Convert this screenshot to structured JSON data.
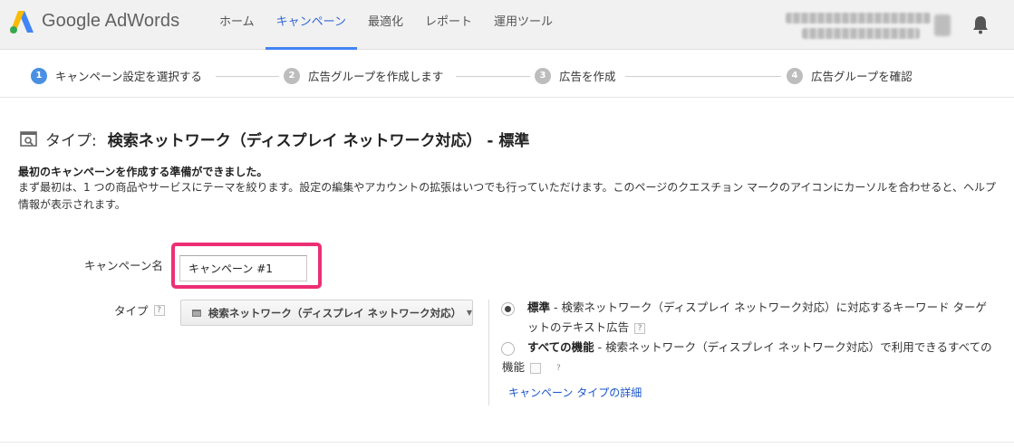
{
  "app": {
    "brand": "Google AdWords",
    "colors": {
      "accent": "#4285f4",
      "highlight": "#ec2f75",
      "step_active": "#4a90e2",
      "link": "#1a55c9"
    }
  },
  "nav": {
    "items": [
      {
        "label": "ホーム",
        "active": false
      },
      {
        "label": "キャンペーン",
        "active": true
      },
      {
        "label": "最適化",
        "active": false
      },
      {
        "label": "レポート",
        "active": false
      },
      {
        "label": "運用ツール",
        "active": false
      }
    ],
    "bell_icon": "bell-icon"
  },
  "steps": [
    {
      "num": "1",
      "label": "キャンペーン設定を選択する",
      "current": true
    },
    {
      "num": "2",
      "label": "広告グループを作成します",
      "current": false
    },
    {
      "num": "3",
      "label": "広告を作成",
      "current": false
    },
    {
      "num": "4",
      "label": "広告グループを確認",
      "current": false
    }
  ],
  "heading": {
    "prefix": "タイプ:",
    "value": "検索ネットワーク（ディスプレイ ネットワーク対応） - 標準",
    "icon": "search-network-icon"
  },
  "intro": {
    "bold": "最初のキャンペーンを作成する準備ができました。",
    "text": "まず最初は、1 つの商品やサービスにテーマを絞ります。設定の編集やアカウントの拡張はいつでも行っていただけます。このページのクエスチョン マークのアイコンにカーソルを合わせると、ヘルプ情報が表示されます。"
  },
  "form": {
    "name_label": "キャンペーン名",
    "name_value": "キャンペーン #1",
    "type_label": "タイプ",
    "help_mark": "?",
    "type_dropdown": "検索ネットワーク（ディスプレイ ネットワーク対応）",
    "options": [
      {
        "title": "標準",
        "desc": " - 検索ネットワーク（ディスプレイ ネットワーク対応）に対応するキーワード ターゲットのテキスト広告",
        "checked": true
      },
      {
        "title": "すべての機能",
        "desc": " - 検索ネットワーク（ディスプレイ ネットワーク対応）で利用できるすべての機能",
        "checked": false
      }
    ],
    "details_link": "キャンペーン タイプの詳細"
  }
}
